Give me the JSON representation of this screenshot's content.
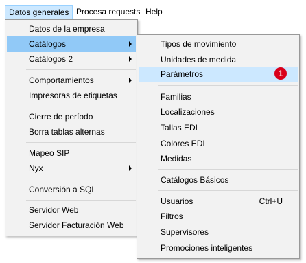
{
  "menubar": {
    "items": [
      "Datos generales",
      "Procesa requests",
      "Help"
    ]
  },
  "menu_main": {
    "items": [
      "Datos de la empresa",
      "Catálogos",
      "Catálogos 2",
      "Comportamientos",
      "Impresoras de etiquetas",
      "Cierre de período",
      "Borra tablas alternas",
      "Mapeo SIP",
      "Nyx",
      "Conversión a SQL",
      "Servidor Web",
      "Servidor Facturación Web"
    ]
  },
  "menu_sub": {
    "items": [
      "Tipos de movimiento",
      "Unidades de medida",
      "Parámetros",
      "Familias",
      "Localizaciones",
      "Tallas EDI",
      "Colores EDI",
      "Medidas",
      "Catálogos Básicos",
      "Usuarios",
      "Filtros",
      "Supervisores",
      "Promociones inteligentes"
    ],
    "usuarios_shortcut": "Ctrl+U"
  },
  "annotation": {
    "badge": "1",
    "color": "#d9001b"
  },
  "colors": {
    "highlight": "#91c9f7",
    "menubar_open": "#cce8ff",
    "menu_bg": "#f2f2f2"
  }
}
